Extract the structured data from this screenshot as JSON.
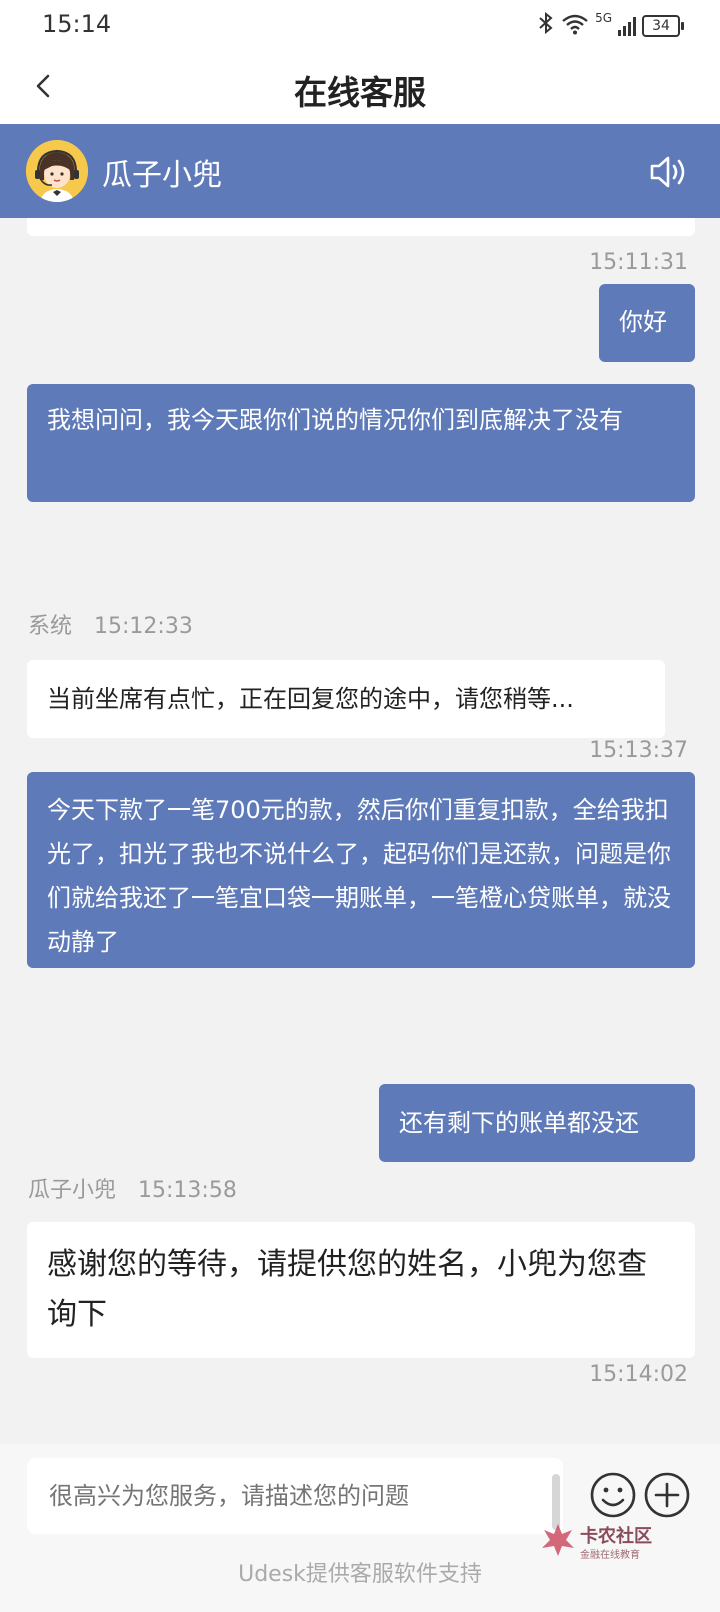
{
  "status_bar": {
    "time": "15:14",
    "network": "5G",
    "battery": "34"
  },
  "title_bar": {
    "title": "在线客服"
  },
  "agent": {
    "name": "瓜子小兜"
  },
  "messages": {
    "ts1": "15:11:31",
    "out1": "你好",
    "out2": "我想问问，我今天跟你们说的情况你们到底解决了没有",
    "sys_sender": "系统",
    "sys_time": "15:12:33",
    "sys_text": "当前坐席有点忙，正在回复您的途中，请您稍等...",
    "ts2": "15:13:37",
    "out3": "今天下款了一笔700元的款，然后你们重复扣款，全给我扣光了，扣光了我也不说什么了，起码你们是还款，问题是你们就给我还了一笔宜口袋一期账单，一笔橙心贷账单，就没动静了",
    "out4": "还有剩下的账单都没还",
    "agent_sender": "瓜子小兜",
    "agent_time": "15:13:58",
    "agent_text": "感谢您的等待，请提供您的姓名，小兜为您查询下",
    "ts3": "15:14:02"
  },
  "input": {
    "placeholder": "很高兴为您服务，请描述您的问题"
  },
  "footer": {
    "support": "Udesk提供客服软件支持"
  },
  "watermark": {
    "main": "卡农社区",
    "sub": "金融在线教育"
  },
  "colors": {
    "accent": "#5f7ab8",
    "background": "#f2f2f2",
    "bubble_in": "#ffffff"
  }
}
